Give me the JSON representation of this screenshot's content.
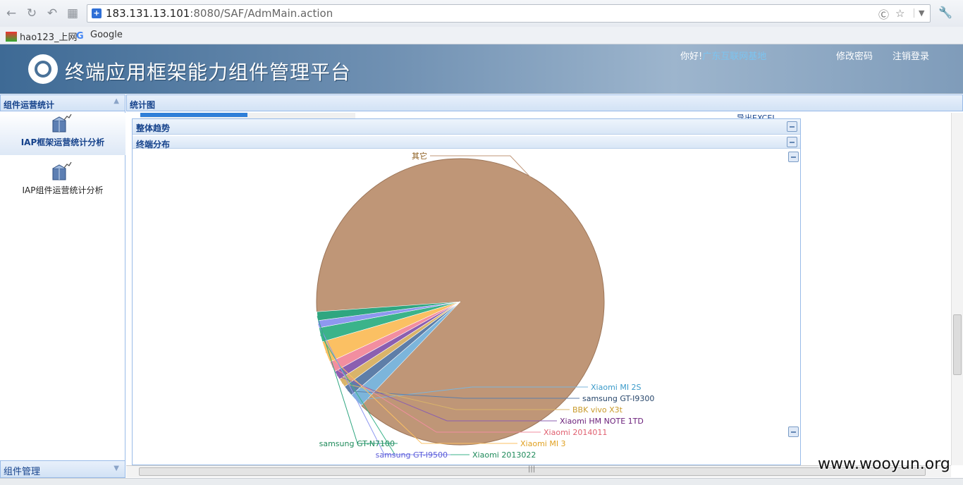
{
  "browser": {
    "url_host": "183.131.13.101",
    "url_rest": ":8080/SAF/AdmMain.action",
    "bookmarks": [
      "hao123_上网",
      "Google"
    ]
  },
  "header": {
    "title": "终端应用框架能力组件管理平台",
    "greeting": "你好!",
    "user": "广东互联网基地",
    "change_password": "修改密码",
    "logout": "注销登录"
  },
  "sidebar": {
    "panel_title": "组件运营统计",
    "items": [
      {
        "label": "IAP框架运营统计分析",
        "active": true
      },
      {
        "label": "IAP组件运营统计分析",
        "active": false
      }
    ],
    "footer_title": "组件管理"
  },
  "main": {
    "tab_title": "统计图",
    "export_label": "导出EXCEL",
    "sections": [
      "整体趋势",
      "终端分布"
    ]
  },
  "watermark": "www.wooyun.org",
  "chart_data": {
    "type": "pie",
    "start_angle_deg": 176,
    "slices": [
      {
        "name": "其它",
        "value": 88.2,
        "color": "#bf9677"
      },
      {
        "name": "Xiaomi MI 2S",
        "value": 1.6,
        "color": "#7cb5db"
      },
      {
        "name": "samsung GT-I9300",
        "value": 1.2,
        "color": "#5e7ea8"
      },
      {
        "name": "BBK vivo X3t",
        "value": 1.0,
        "color": "#d9b46a"
      },
      {
        "name": "Xiaomi HM NOTE 1TD",
        "value": 1.0,
        "color": "#8b5fb0"
      },
      {
        "name": "Xiaomi 2014011",
        "value": 1.2,
        "color": "#f28ea0"
      },
      {
        "name": "Xiaomi MI 3",
        "value": 2.4,
        "color": "#fbc063"
      },
      {
        "name": "Xiaomi 2013022",
        "value": 1.6,
        "color": "#3bb38a"
      },
      {
        "name": "samsung GT-I9500",
        "value": 0.8,
        "color": "#8e98f0"
      },
      {
        "name": "samsung GT-N7100",
        "value": 1.0,
        "color": "#2fa680"
      }
    ],
    "label_colors": [
      "#8a5a1a",
      "#3a9ac9",
      "#27466b",
      "#c89a2a",
      "#6a1f7a",
      "#e06070",
      "#e0a020",
      "#1e8a5a",
      "#5a5ad8",
      "#1e8a5a"
    ]
  }
}
